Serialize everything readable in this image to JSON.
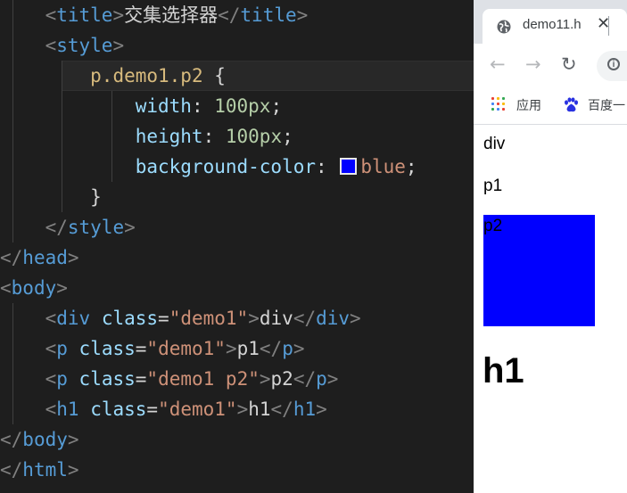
{
  "editor": {
    "lines": [
      {
        "kind": "tag",
        "open": "title",
        "text": "交集选择器",
        "close": "title"
      },
      {
        "kind": "open",
        "tag": "style"
      },
      {
        "selector": "p.demo1.p2",
        "brace": "{"
      },
      {
        "prop": "width",
        "value": "100px"
      },
      {
        "prop": "height",
        "value": "100px"
      },
      {
        "prop": "background-color",
        "value": "blue"
      },
      {
        "brace": "}"
      },
      {
        "kind": "close",
        "tag": "style"
      },
      {
        "kind": "close",
        "tag": "head"
      },
      {
        "kind": "open",
        "tag": "body"
      },
      {
        "tag": "div",
        "attr": "class",
        "value": "\"demo1\"",
        "text": "div"
      },
      {
        "tag": "p",
        "attr": "class",
        "value": "\"demo1\"",
        "text": "p1"
      },
      {
        "tag": "p",
        "attr": "class",
        "value": "\"demo1 p2\"",
        "text": "p2"
      },
      {
        "tag": "h1",
        "attr": "class",
        "value": "\"demo1\"",
        "text": "h1"
      },
      {
        "kind": "close",
        "tag": "body"
      },
      {
        "kind": "close",
        "tag": "html"
      }
    ],
    "swatch_color": "#0000ff"
  },
  "browser": {
    "tab_title": "demo11.h",
    "tab_close": "✕",
    "back_icon": "←",
    "forward_icon": "→",
    "reload_icon": "↻",
    "info_icon": "i",
    "bookmarks": [
      {
        "label": "应用",
        "icon": "apps-grid-icon"
      },
      {
        "label": "百度一",
        "icon": "baidu-paw-icon"
      }
    ],
    "page": {
      "div_text": "div",
      "p1_text": "p1",
      "p2_text": "p2",
      "h1_text": "h1",
      "box_color": "#0000ff"
    }
  }
}
